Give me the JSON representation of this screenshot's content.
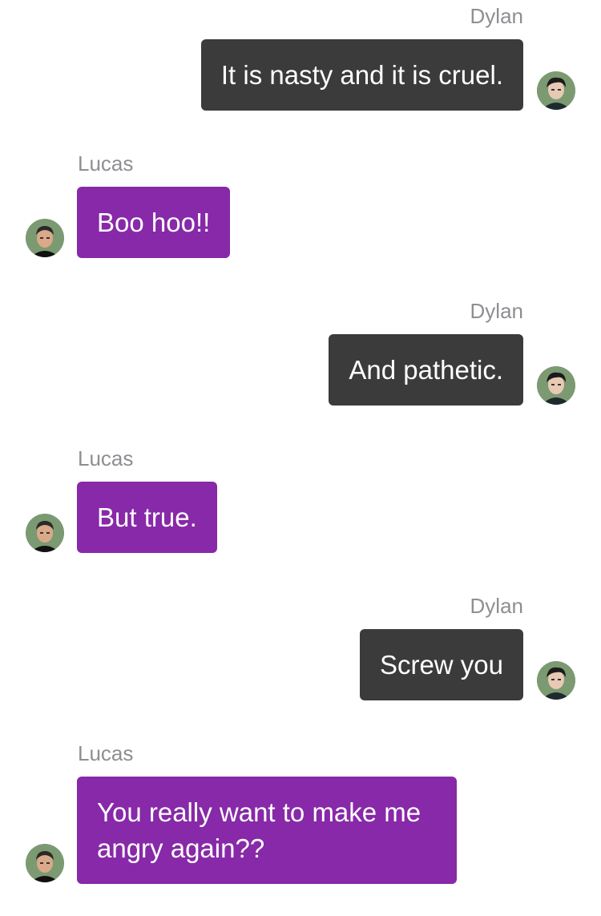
{
  "conversation": {
    "messages": [
      {
        "sender": "Dylan",
        "text": "It is nasty and it is cruel.",
        "side": "right",
        "avatar_icon": "dylan-avatar-icon"
      },
      {
        "sender": "Lucas",
        "text": "Boo hoo!!",
        "side": "left",
        "avatar_icon": "lucas-avatar-icon"
      },
      {
        "sender": "Dylan",
        "text": "And pathetic.",
        "side": "right",
        "avatar_icon": "dylan-avatar-icon"
      },
      {
        "sender": "Lucas",
        "text": "But true.",
        "side": "left",
        "avatar_icon": "lucas-avatar-icon"
      },
      {
        "sender": "Dylan",
        "text": "Screw you",
        "side": "right",
        "avatar_icon": "dylan-avatar-icon"
      },
      {
        "sender": "Lucas",
        "text": "You really want to make me angry again??",
        "side": "left",
        "avatar_icon": "lucas-avatar-icon"
      }
    ]
  },
  "colors": {
    "dylan_bubble": "#3b3b3b",
    "lucas_bubble": "#8729a8",
    "sender_name": "#8e8e93",
    "background": "#ffffff"
  }
}
